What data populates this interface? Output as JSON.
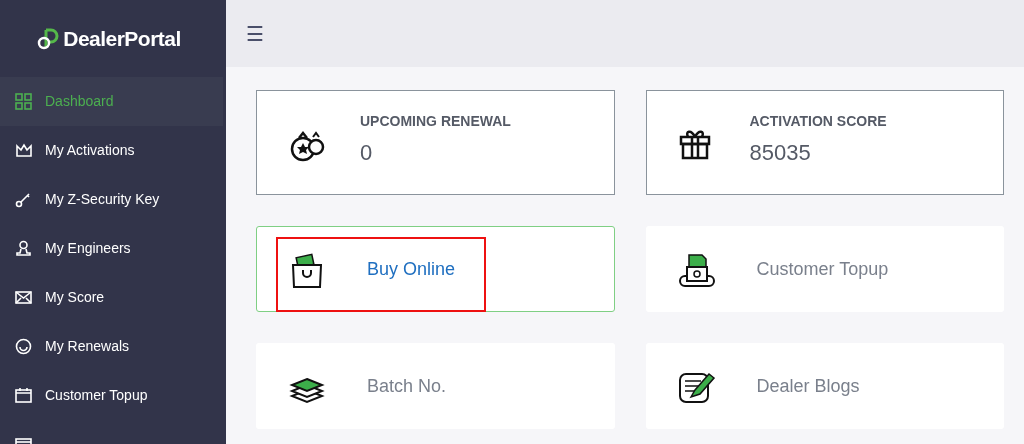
{
  "sidebar": {
    "logo": "DealerPortal",
    "items": [
      {
        "label": "Dashboard",
        "selected": true
      },
      {
        "label": "My Activations",
        "selected": false
      },
      {
        "label": "My Z-Security Key",
        "selected": false
      },
      {
        "label": "My Engineers",
        "selected": false
      },
      {
        "label": "My Score",
        "selected": false
      },
      {
        "label": "My Renewals",
        "selected": false
      },
      {
        "label": "Customer Topup",
        "selected": false
      },
      {
        "selected": false
      }
    ]
  },
  "topbar": {
    "menu": "☰"
  },
  "cards": [
    {
      "kind": "stat",
      "title": "UPCOMING RENEWAL",
      "value": "0"
    },
    {
      "kind": "stat",
      "title": "ACTIVATION SCORE",
      "value": "85035"
    },
    {
      "kind": "link",
      "label": "Buy Online",
      "selected": true,
      "marked": true
    },
    {
      "kind": "link",
      "label": "Customer Topup",
      "selected": false,
      "marked": false
    },
    {
      "kind": "link",
      "label": "Batch No.",
      "selected": false,
      "marked": false
    },
    {
      "kind": "link",
      "label": "Dealer Blogs",
      "selected": false,
      "marked": false
    }
  ]
}
